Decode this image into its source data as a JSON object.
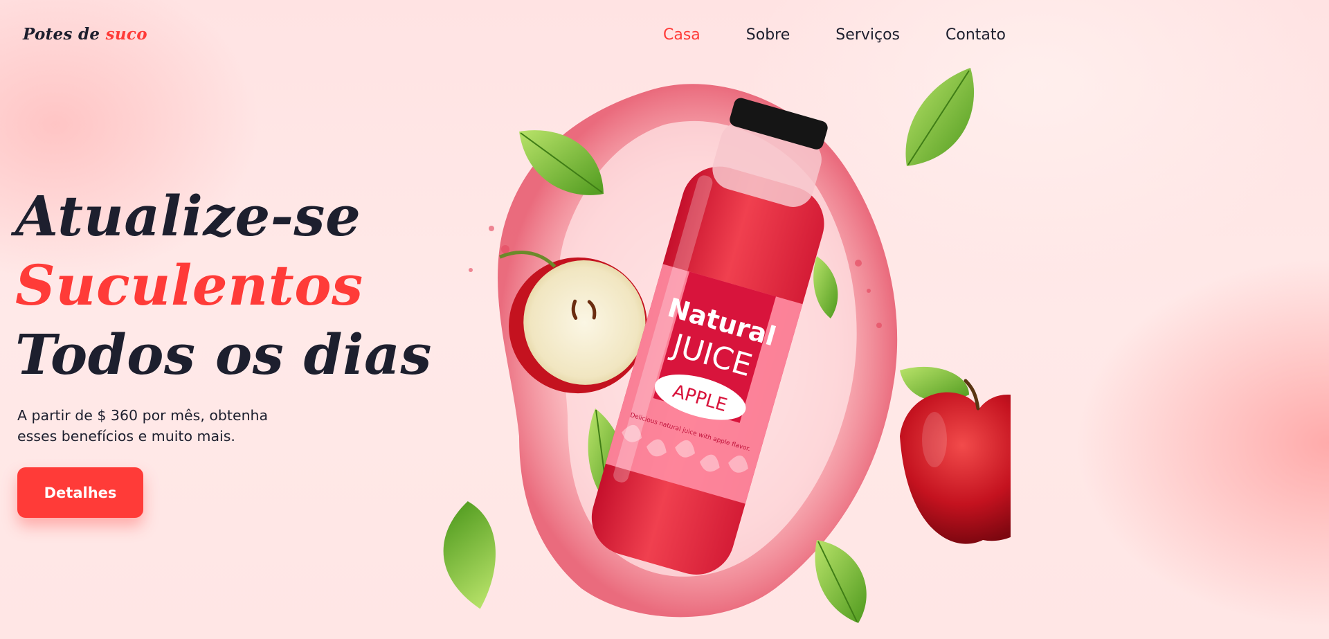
{
  "brand": {
    "name_part1": "Potes de ",
    "name_part2": "suco"
  },
  "nav": {
    "items": [
      {
        "label": "Casa",
        "active": true
      },
      {
        "label": "Sobre",
        "active": false
      },
      {
        "label": "Serviços",
        "active": false
      },
      {
        "label": "Contato",
        "active": false
      }
    ]
  },
  "hero": {
    "line1": "Atualize-se",
    "line2": "Suculentos",
    "line3": "Todos os dias",
    "subtitle": "A partir de $ 360 por mês, obtenha esses benefícios e muito mais.",
    "cta_label": "Detalhes"
  },
  "product": {
    "label_line1": "Natural",
    "label_line2": "JUICE",
    "flavor": "APPLE",
    "tagline": "Delicious natural juice with apple flavor."
  },
  "colors": {
    "accent": "#ff3b38",
    "text": "#1d1f2e",
    "background": "#ffe6e5"
  }
}
